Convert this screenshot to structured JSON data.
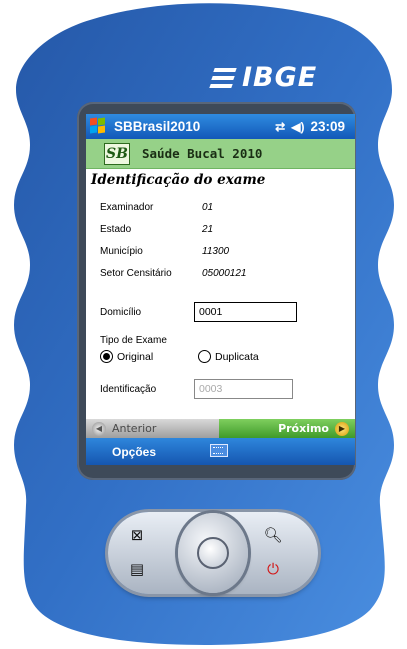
{
  "brand": {
    "logo_text": "IBGE"
  },
  "titlebar": {
    "app_name": "SBBrasil2010",
    "time": "23:09",
    "connectivity_icon": "sync-arrows-icon",
    "volume_icon": "speaker-icon"
  },
  "banner": {
    "logo_text": "SB",
    "title": "Saúde Bucal 2010"
  },
  "form": {
    "heading": "Identificação do exame",
    "info": [
      {
        "label": "Examinador",
        "value": "01"
      },
      {
        "label": "Estado",
        "value": "21"
      },
      {
        "label": "Município",
        "value": "11300"
      },
      {
        "label": "Setor Censitário",
        "value": "05000121"
      }
    ],
    "domicilio_label": "Domicílio",
    "domicilio_value": "0001",
    "tipo_label": "Tipo de Exame",
    "option_original": "Original",
    "option_duplicata": "Duplicata",
    "selected_option": "Original",
    "identificacao_label": "Identificação",
    "identificacao_value": "0003"
  },
  "navigation": {
    "prev_label": "Anterior",
    "next_label": "Próximo"
  },
  "softkeys": {
    "left_label": "Opções",
    "keyboard_icon": "keyboard-icon"
  },
  "hardware": {
    "buttons": [
      "calendar-icon",
      "contacts-icon",
      "zoom-icon",
      "power-icon"
    ]
  },
  "colors": {
    "titlebar": "#1e6fcc",
    "banner": "#96d188",
    "next_button": "#4ea834",
    "device_body": "#2f6cc0"
  }
}
